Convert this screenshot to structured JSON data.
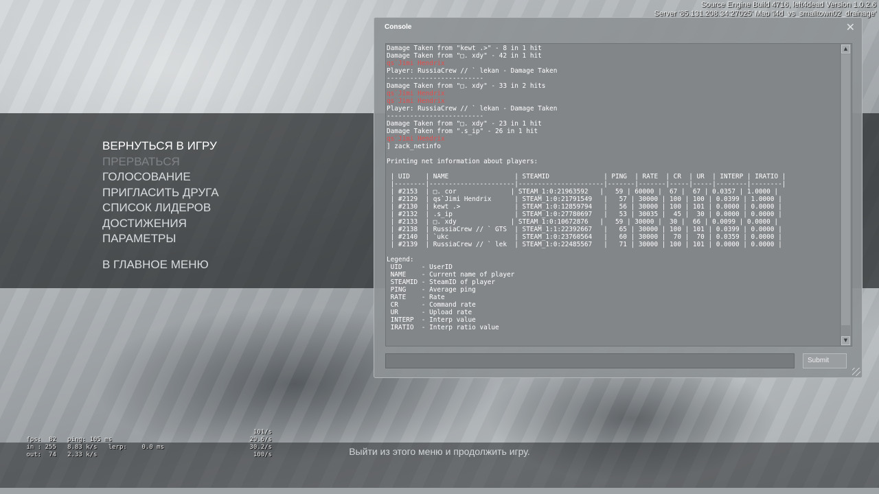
{
  "build_info": {
    "line1": "Source Engine Build 4716, left4dead Version 1.0.2.6",
    "line2": "Server '85.131.208.34:27025' Map 'l4d_vs_smalltown02_drainage'"
  },
  "menu": {
    "items": [
      {
        "label": "ВЕРНУТЬСЯ В ИГРУ",
        "state": "active"
      },
      {
        "label": "ПРЕРВАТЬСЯ",
        "state": "disabled"
      },
      {
        "label": "ГОЛОСОВАНИЕ",
        "state": "normal"
      },
      {
        "label": "ПРИГЛАСИТЬ ДРУГА",
        "state": "normal"
      },
      {
        "label": "СПИСОК ЛИДЕРОВ",
        "state": "normal"
      },
      {
        "label": "ДОСТИЖЕНИЯ",
        "state": "normal"
      },
      {
        "label": "ПАРАМЕТРЫ",
        "state": "normal"
      },
      {
        "label": "В ГЛАВНОЕ МЕНЮ",
        "state": "normal"
      }
    ]
  },
  "hint": "Выйти из этого меню и продолжить игру.",
  "netgraph": {
    "lines": [
      {
        "left": "fps:  82   ping: 105 ms",
        "right": "101/s"
      },
      {
        "left": "in : 255   8.83 k/s   lerp:    0.0 ms",
        "right": "29.6/s"
      },
      {
        "left": "out:  74   2.33 k/s",
        "right": "30.2/s"
      },
      {
        "left": "",
        "right": "100/s"
      }
    ]
  },
  "console": {
    "title": "Console",
    "close_glyph": "✕",
    "submit_label": "Submit",
    "input_value": "",
    "scroll_up_glyph": "▲",
    "scroll_down_glyph": "▼",
    "lines": [
      {
        "text": "Damage Taken from \"kewt .>\" - 8 in 1 hit",
        "color": "white"
      },
      {
        "text": "Damage Taken from \"□. xdy\" - 42 in 1 hit",
        "color": "white"
      },
      {
        "text": "qs`Jimi Hendrix",
        "color": "red"
      },
      {
        "text": "Player: RussiaCrew // ` lekan - Damage Taken",
        "color": "white"
      },
      {
        "text": "-------------------------",
        "color": "white"
      },
      {
        "text": "Damage Taken from \"□. xdy\" - 33 in 2 hits",
        "color": "white"
      },
      {
        "text": "qs`Jimi Hendrix",
        "color": "red"
      },
      {
        "text": "qs`Jimi Hendrix",
        "color": "red"
      },
      {
        "text": "Player: RussiaCrew // ` lekan - Damage Taken",
        "color": "white"
      },
      {
        "text": "-------------------------",
        "color": "white"
      },
      {
        "text": "Damage Taken from \"□. xdy\" - 23 in 1 hit",
        "color": "white"
      },
      {
        "text": "Damage Taken from \".s_ip\" - 26 in 1 hit",
        "color": "white"
      },
      {
        "text": "qs`Jimi Hendrix",
        "color": "red"
      },
      {
        "text": "] zack_netinfo",
        "color": "white"
      },
      {
        "text": "",
        "color": "white"
      },
      {
        "text": "Printing net information about players:",
        "color": "white"
      },
      {
        "text": "",
        "color": "white"
      },
      {
        "text": " | UID    | NAME                 | STEAMID              | PING  | RATE  | CR  | UR  | INTERP | IRATIO |",
        "color": "white"
      },
      {
        "text": " |--------|----------------------|----------------------|-------|-------|-----|-----|--------|--------|",
        "color": "white"
      },
      {
        "text": " | #2153  | □. cor              | STEAM_1:0:21963592   |   59 | 60000 |  67 |  67 | 0.0357 | 1.0000 |",
        "color": "white"
      },
      {
        "text": " | #2129  | qs`Jimi Hendrix      | STEAM_1:0:21791549   |   57 | 30000 | 100 | 100 | 0.0399 | 1.0000 |",
        "color": "white"
      },
      {
        "text": " | #2130  | kewt .>              | STEAM_1:0:12859794   |   56 | 30000 | 100 | 101 | 0.0000 | 0.0000 |",
        "color": "white"
      },
      {
        "text": " | #2132  | .s_ip                | STEAM_1:0:27780697   |   53 | 30035 |  45 |  30 | 0.0000 | 0.0000 |",
        "color": "white"
      },
      {
        "text": " | #2133  | □. xdy              | STEAM_1:0:10672876   |   59 | 30000 |  30 |  66 | 0.0099 | 0.0000 |",
        "color": "white"
      },
      {
        "text": " | #2138  | RussiaCrew // ` GTS  | STEAM_1:1:22392667   |   65 | 30000 | 100 | 101 | 0.0399 | 0.0000 |",
        "color": "white"
      },
      {
        "text": " | #2140  | `ukc                 | STEAM_1:0:23760564   |   60 | 30000 |  70 |  70 | 0.0359 | 0.0000 |",
        "color": "white"
      },
      {
        "text": " | #2139  | RussiaCrew // ` lek  | STEAM_1:0:22485567   |   71 | 30000 | 100 | 101 | 0.0000 | 0.0000 |",
        "color": "white"
      },
      {
        "text": "",
        "color": "white"
      },
      {
        "text": "Legend:",
        "color": "white"
      },
      {
        "text": " UID     - UserID",
        "color": "white"
      },
      {
        "text": " NAME    - Current name of player",
        "color": "white"
      },
      {
        "text": " STEAMID - SteamID of player",
        "color": "white"
      },
      {
        "text": " PING    - Average ping",
        "color": "white"
      },
      {
        "text": " RATE    - Rate",
        "color": "white"
      },
      {
        "text": " CR      - Command rate",
        "color": "white"
      },
      {
        "text": " UR      - Upload rate",
        "color": "white"
      },
      {
        "text": " INTERP  - Interp value",
        "color": "white"
      },
      {
        "text": " IRATIO  - Interp ratio value",
        "color": "white"
      }
    ]
  },
  "colors": {
    "console_text": "#ffffff",
    "console_red": "#e44e4e",
    "menu_active": "#ffffff",
    "menu_disabled": "#7e8286"
  }
}
